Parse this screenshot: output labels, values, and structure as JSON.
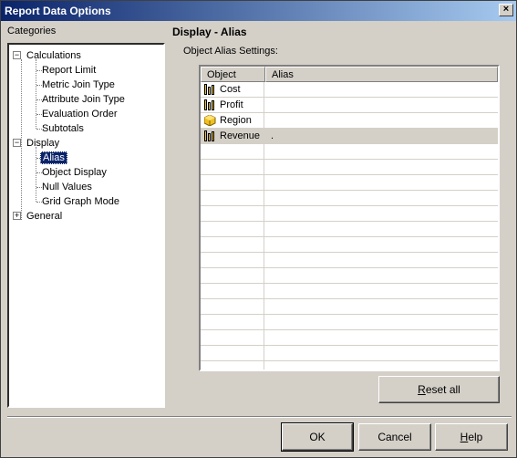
{
  "window": {
    "title": "Report Data Options",
    "close_label": "×"
  },
  "categories": {
    "label": "Categories",
    "tree": [
      {
        "label": "Calculations",
        "expanded": true,
        "children": [
          "Report Limit",
          "Metric Join Type",
          "Attribute Join Type",
          "Evaluation Order",
          "Subtotals"
        ]
      },
      {
        "label": "Display",
        "expanded": true,
        "children": [
          "Alias",
          "Object Display",
          "Null Values",
          "Grid Graph Mode"
        ],
        "selected_child": "Alias"
      },
      {
        "label": "General",
        "expanded": false,
        "children": []
      }
    ],
    "expander_minus": "−",
    "expander_plus": "+"
  },
  "panel": {
    "title": "Display - Alias",
    "section_label": "Object Alias Settings:",
    "grid": {
      "columns": [
        "Object",
        "Alias"
      ],
      "rows": [
        {
          "object": "Cost",
          "icon": "metric-icon",
          "alias": ""
        },
        {
          "object": "Profit",
          "icon": "metric-icon",
          "alias": ""
        },
        {
          "object": "Region",
          "icon": "attribute-icon",
          "alias": ""
        },
        {
          "object": "Revenue",
          "icon": "metric-icon",
          "alias": "."
        }
      ],
      "selected_row": 3
    }
  },
  "buttons": {
    "reset_all_prefix": "R",
    "reset_all_rest": "eset all",
    "ok": "OK",
    "cancel": "Cancel",
    "help_prefix": "H",
    "help_rest": "elp"
  },
  "colors": {
    "titlebar_start": "#0a246a",
    "titlebar_end": "#a6caf0",
    "selection": "#0a246a",
    "face": "#d4d0c8"
  }
}
